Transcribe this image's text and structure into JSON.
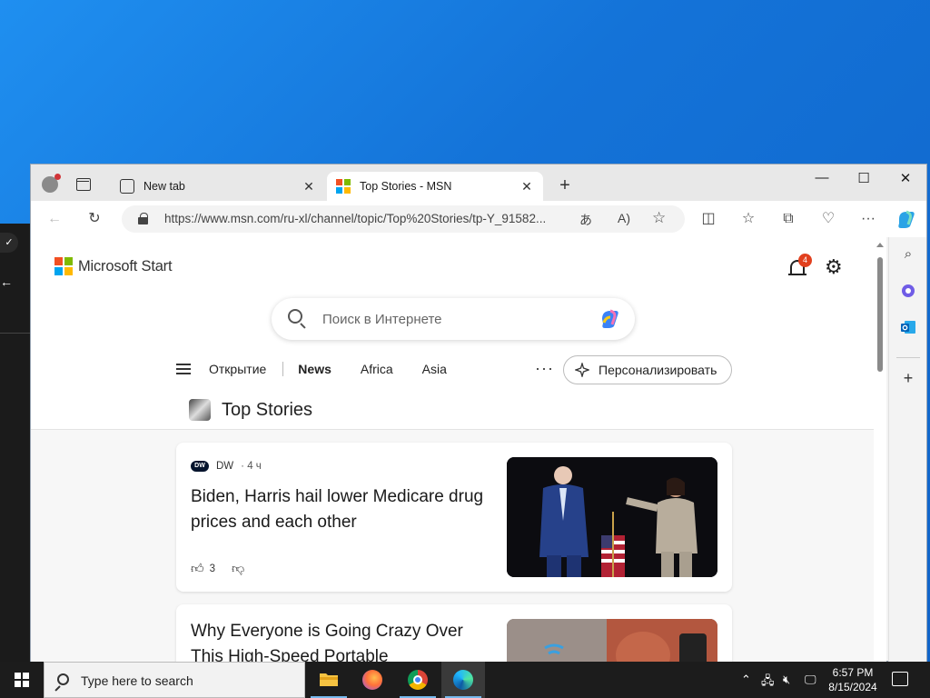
{
  "window": {
    "tabs": [
      {
        "title": "New tab",
        "active": false
      },
      {
        "title": "Top Stories - MSN",
        "active": true
      }
    ],
    "controls": {
      "minimize": "—",
      "maximize": "☐",
      "close": "✕"
    }
  },
  "toolbar": {
    "url": "https://www.msn.com/ru-xl/channel/topic/Top%20Stories/tp-Y_91582..."
  },
  "page": {
    "brand": "Microsoft Start",
    "notifications_count": "4",
    "search": {
      "placeholder": "Поиск в Интернете"
    },
    "nav": {
      "items": [
        "Открытие",
        "News",
        "Africa",
        "Asia"
      ],
      "more": "···",
      "personalize": "Персонализировать"
    },
    "section_title": "Top Stories",
    "cards": [
      {
        "source": "DW",
        "age": "· 4 ч",
        "title": "Biden, Harris hail lower Medicare drug prices and each other",
        "likes": "3"
      },
      {
        "title": "Why Everyone is Going Crazy Over This High-Speed Portable"
      }
    ]
  },
  "taskbar": {
    "search_placeholder": "Type here to search",
    "time": "6:57 PM",
    "date": "8/15/2024"
  },
  "colors": {
    "desktop": "#1473d8",
    "accent": "#0067c0",
    "badge": "#e1401e"
  }
}
